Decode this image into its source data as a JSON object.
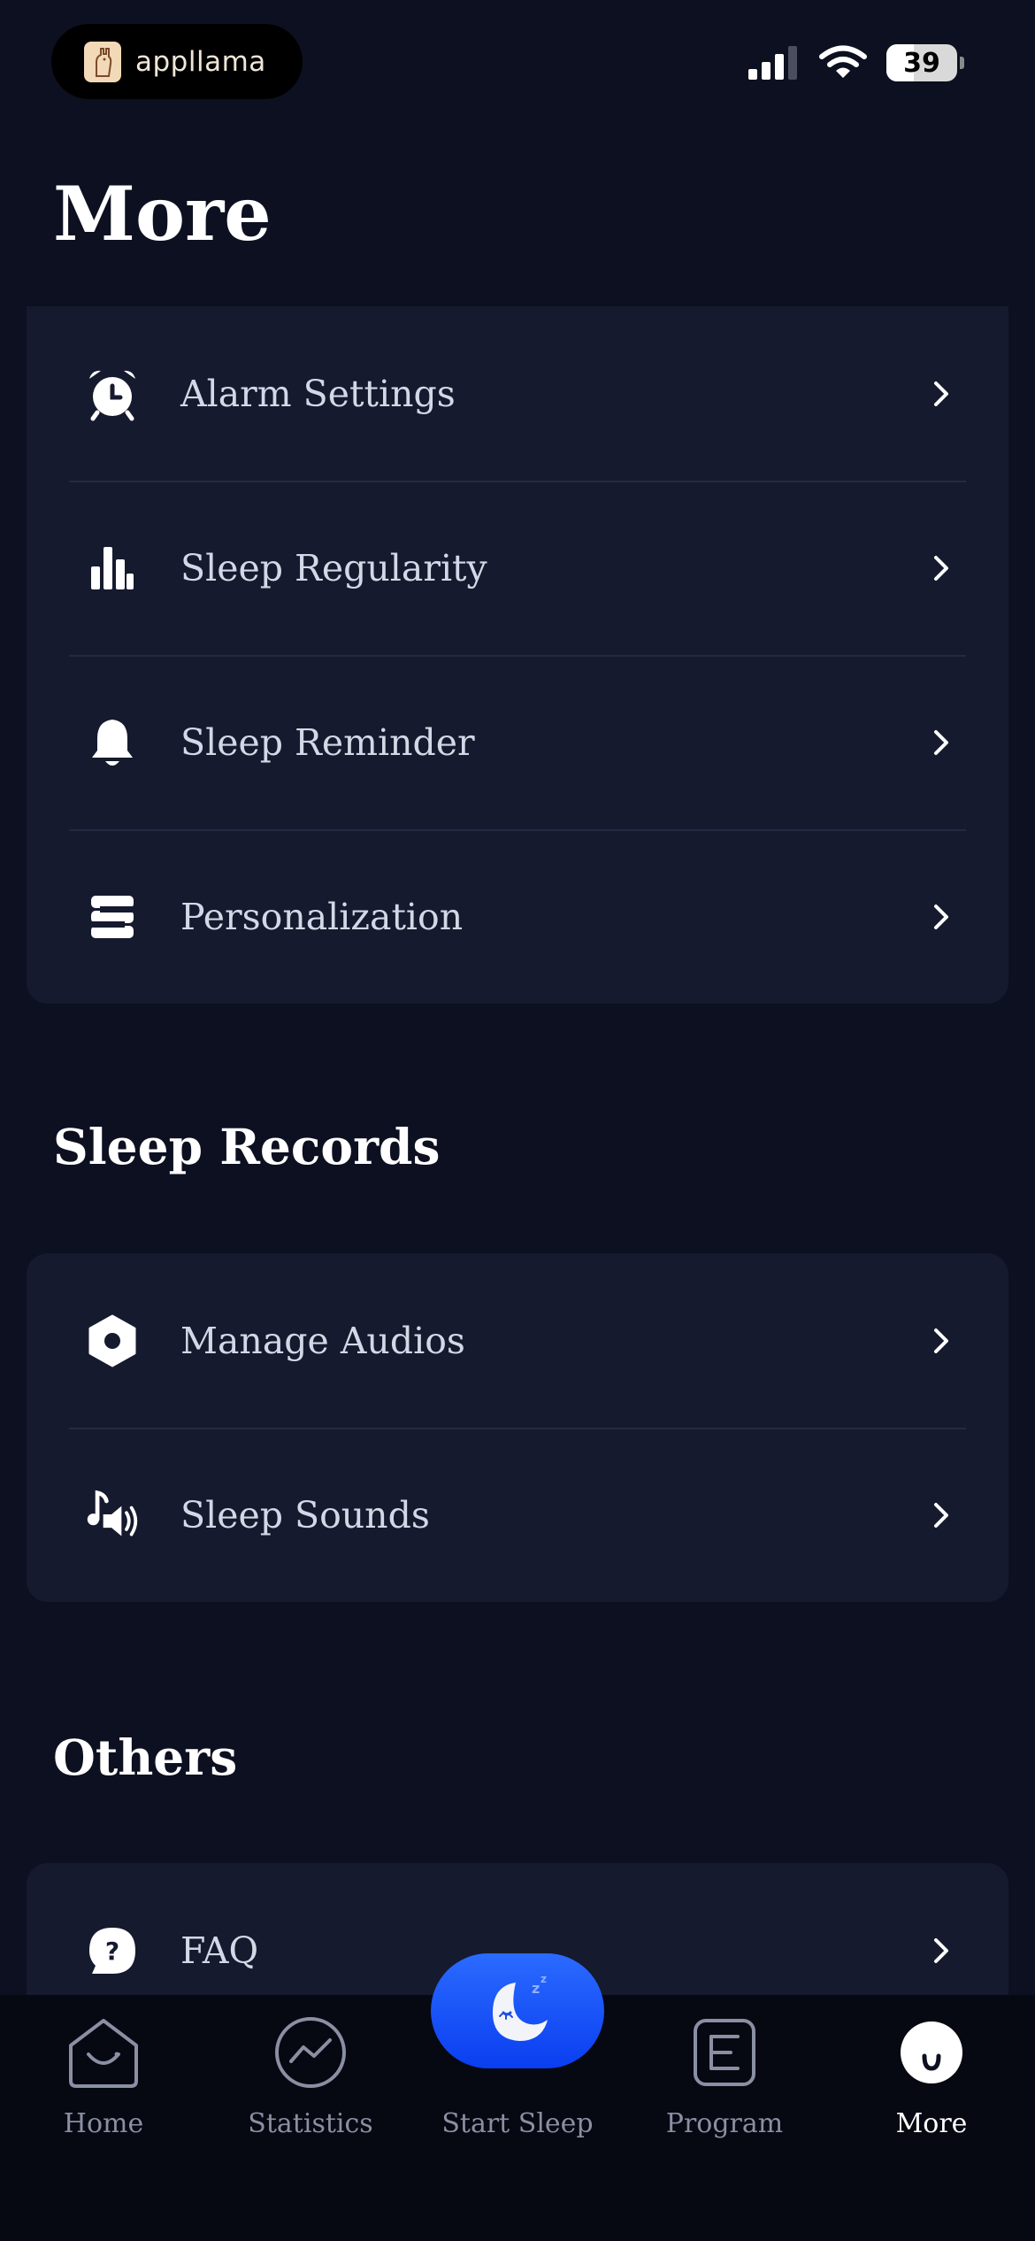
{
  "status_bar": {
    "brand": "appllama",
    "battery": "39",
    "battery_level": 0.39
  },
  "page_title": "More",
  "settings": [
    {
      "label": "Alarm Settings",
      "icon": "alarm-clock-icon"
    },
    {
      "label": "Sleep Regularity",
      "icon": "bar-chart-icon"
    },
    {
      "label": "Sleep Reminder",
      "icon": "bell-icon"
    },
    {
      "label": "Personalization",
      "icon": "personalization-icon"
    }
  ],
  "sleep_records": {
    "title": "Sleep Records",
    "items": [
      {
        "label": "Manage Audios",
        "icon": "hexagon-record-icon"
      },
      {
        "label": "Sleep Sounds",
        "icon": "music-speaker-icon"
      }
    ]
  },
  "others": {
    "title": "Others",
    "items": [
      {
        "label": "FAQ",
        "icon": "question-bubble-icon"
      }
    ]
  },
  "tabbar": {
    "home": "Home",
    "statistics": "Statistics",
    "start_sleep": "Start Sleep",
    "program": "Program",
    "more": "More",
    "active": "More"
  },
  "colors": {
    "background": "#0d1020",
    "card": "#161a2e",
    "accent": "#1f55ff",
    "text_muted": "#8a8fa3"
  }
}
